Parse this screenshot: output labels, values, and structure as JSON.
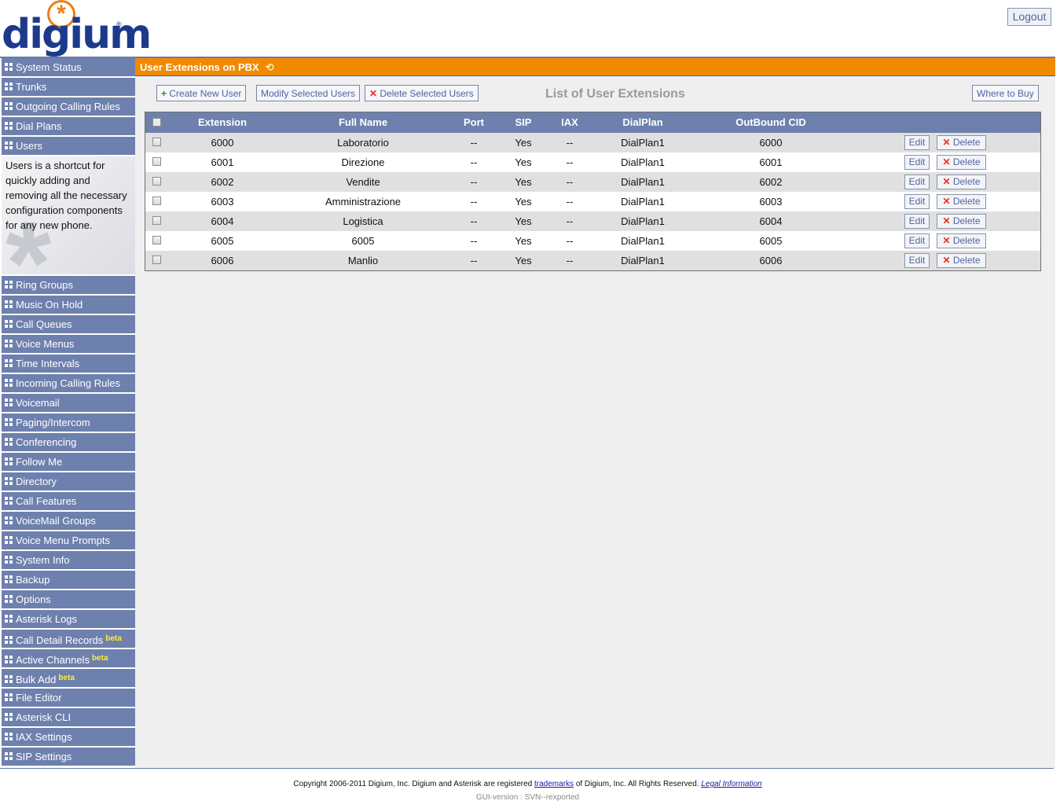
{
  "header": {
    "logo_text": "digium",
    "logo_mark": "*",
    "logout_label": "Logout"
  },
  "sidebar": {
    "top_items": [
      {
        "label": "System Status"
      },
      {
        "label": "Trunks"
      },
      {
        "label": "Outgoing Calling Rules"
      },
      {
        "label": "Dial Plans"
      },
      {
        "label": "Users"
      }
    ],
    "description": "Users is a shortcut for quickly adding and removing all the necessary configuration components for any new phone.",
    "bottom_items": [
      {
        "label": "Ring Groups",
        "beta": ""
      },
      {
        "label": "Music On Hold",
        "beta": ""
      },
      {
        "label": "Call Queues",
        "beta": ""
      },
      {
        "label": "Voice Menus",
        "beta": ""
      },
      {
        "label": "Time Intervals",
        "beta": ""
      },
      {
        "label": "Incoming Calling Rules",
        "beta": ""
      },
      {
        "label": "Voicemail",
        "beta": ""
      },
      {
        "label": "Paging/Intercom",
        "beta": ""
      },
      {
        "label": "Conferencing",
        "beta": ""
      },
      {
        "label": "Follow Me",
        "beta": ""
      },
      {
        "label": "Directory",
        "beta": ""
      },
      {
        "label": "Call Features",
        "beta": ""
      },
      {
        "label": "VoiceMail Groups",
        "beta": ""
      },
      {
        "label": "Voice Menu Prompts",
        "beta": ""
      },
      {
        "label": "System Info",
        "beta": ""
      },
      {
        "label": "Backup",
        "beta": ""
      },
      {
        "label": "Options",
        "beta": ""
      },
      {
        "label": "Asterisk Logs",
        "beta": ""
      },
      {
        "label": "Call Detail Records",
        "beta": "beta"
      },
      {
        "label": "Active Channels",
        "beta": "beta"
      },
      {
        "label": "Bulk Add",
        "beta": "beta"
      },
      {
        "label": "File Editor",
        "beta": ""
      },
      {
        "label": "Asterisk CLI",
        "beta": ""
      },
      {
        "label": "IAX Settings",
        "beta": ""
      },
      {
        "label": "SIP Settings",
        "beta": ""
      }
    ]
  },
  "main": {
    "title": "User Extensions on PBX",
    "toolbar": {
      "create_label": "Create New User",
      "modify_label": "Modify Selected Users",
      "delete_label": "Delete Selected Users",
      "where_label": "Where to Buy"
    },
    "list_title": "List of User Extensions",
    "columns": [
      "Extension",
      "Full Name",
      "Port",
      "SIP",
      "IAX",
      "DialPlan",
      "OutBound CID"
    ],
    "edit_label": "Edit",
    "delete_label": "Delete",
    "rows": [
      {
        "extension": "6000",
        "full_name": "Laboratorio",
        "port": "--",
        "sip": "Yes",
        "iax": "--",
        "dialplan": "DialPlan1",
        "cid": "6000"
      },
      {
        "extension": "6001",
        "full_name": "Direzione",
        "port": "--",
        "sip": "Yes",
        "iax": "--",
        "dialplan": "DialPlan1",
        "cid": "6001"
      },
      {
        "extension": "6002",
        "full_name": "Vendite",
        "port": "--",
        "sip": "Yes",
        "iax": "--",
        "dialplan": "DialPlan1",
        "cid": "6002"
      },
      {
        "extension": "6003",
        "full_name": "Amministrazione",
        "port": "--",
        "sip": "Yes",
        "iax": "--",
        "dialplan": "DialPlan1",
        "cid": "6003"
      },
      {
        "extension": "6004",
        "full_name": "Logistica",
        "port": "--",
        "sip": "Yes",
        "iax": "--",
        "dialplan": "DialPlan1",
        "cid": "6004"
      },
      {
        "extension": "6005",
        "full_name": "6005",
        "port": "--",
        "sip": "Yes",
        "iax": "--",
        "dialplan": "DialPlan1",
        "cid": "6005"
      },
      {
        "extension": "6006",
        "full_name": "Manlio",
        "port": "--",
        "sip": "Yes",
        "iax": "--",
        "dialplan": "DialPlan1",
        "cid": "6006"
      }
    ]
  },
  "footer": {
    "copyright_pre": "Copyright 2006-2011 Digium, Inc. Digium and Asterisk are registered",
    "trademarks_link": "trademarks",
    "copyright_post": "of Digium, Inc. All Rights Reserved.",
    "legal_link": "Legal Information",
    "version": "GUI-version : SVN--rexported"
  },
  "colors": {
    "nav": "#6e80ad",
    "title_bar": "#f08a00",
    "logo_blue": "#1d3a8a",
    "logo_orange": "#f07d12"
  }
}
